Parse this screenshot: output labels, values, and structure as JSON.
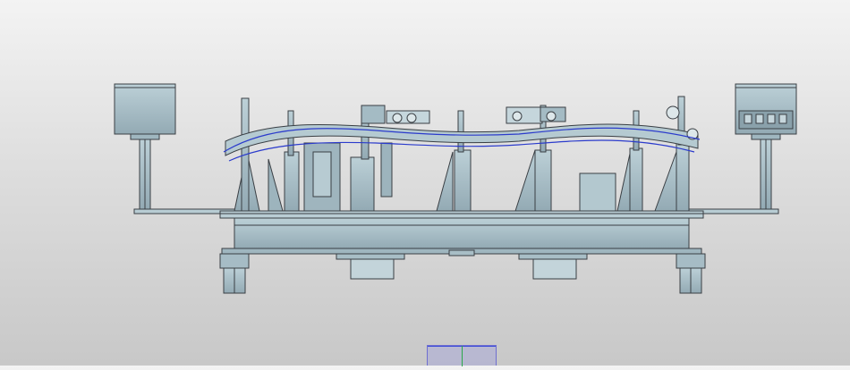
{
  "colors": {
    "background_top": "#f3f3f3",
    "background_bottom": "#c8c8c8",
    "steel": "#a9c0c8",
    "steel_dark": "#7f98a3",
    "edge": "#3a3f44",
    "curve": "#2b3bcc"
  },
  "view": {
    "type": "3d-cad-viewport",
    "model": "welding-fixture-assembly"
  },
  "icons": {
    "orientation": "axis-triad-icon"
  }
}
